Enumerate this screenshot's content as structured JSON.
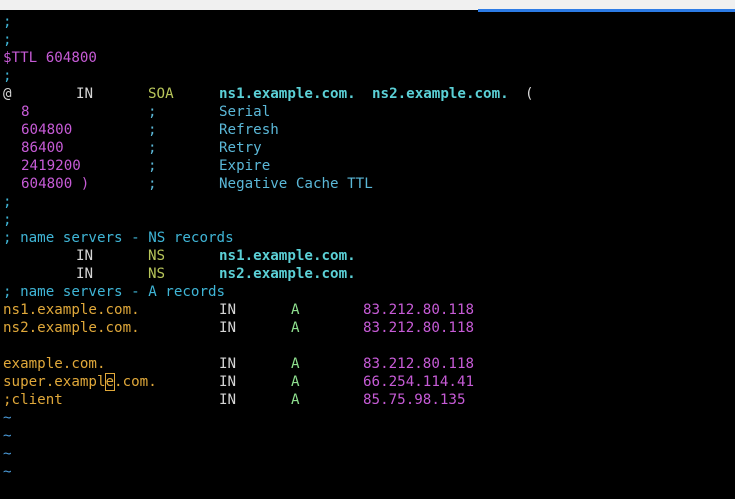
{
  "editor": {
    "l1": ";",
    "l2": ";",
    "l3": "$TTL 604800",
    "l4": ";",
    "soa": {
      "at": "@",
      "in": "IN",
      "type": "SOA",
      "primary": "ns1.example.com.",
      "contact": "ns2.example.com.",
      "paren": "("
    },
    "serial": {
      "value": "8",
      "semi": ";",
      "label": "Serial"
    },
    "refresh": {
      "value": "604800",
      "semi": ";",
      "label": "Refresh"
    },
    "retry": {
      "value": "86400",
      "semi": ";",
      "label": "Retry"
    },
    "expire": {
      "value": "2419200",
      "semi": ";",
      "label": "Expire"
    },
    "negttl": {
      "value": "604800 )",
      "semi": ";",
      "label": "Negative Cache TTL"
    },
    "l11": ";",
    "l12": ";",
    "ns_comment": "; name servers - NS records",
    "ns1": {
      "in": "IN",
      "type": "NS",
      "host": "ns1.example.com."
    },
    "ns2": {
      "in": "IN",
      "type": "NS",
      "host": "ns2.example.com."
    },
    "a_comment": "; name servers - A records",
    "a1": {
      "name": "ns1.example.com.",
      "in": "IN",
      "type": "A",
      "ip": "83.212.80.118"
    },
    "a2": {
      "name": "ns2.example.com.",
      "in": "IN",
      "type": "A",
      "ip": "83.212.80.118"
    },
    "a3": {
      "name": "example.com.",
      "in": "IN",
      "type": "A",
      "ip": "83.212.80.118"
    },
    "a4": {
      "name_pre": "super.exampl",
      "name_cur": "e",
      "name_post": ".com.",
      "in": "IN",
      "type": "A",
      "ip": "66.254.114.41"
    },
    "a5": {
      "name": ";client",
      "in": "IN",
      "type": "A",
      "ip": "85.75.98.135"
    },
    "tilde": "~"
  }
}
